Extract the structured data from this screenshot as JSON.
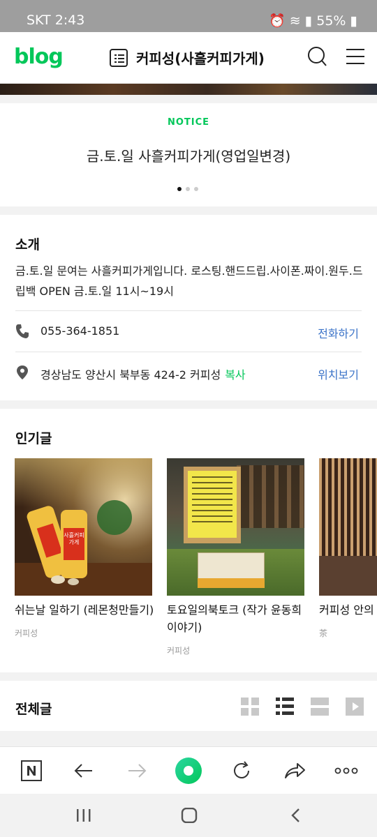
{
  "status": {
    "carrier_time": "SKT 2:43",
    "battery": "55%"
  },
  "header": {
    "logo": "blog",
    "title": "커피성(사흘커피가게)"
  },
  "notice": {
    "label": "NOTICE",
    "text": "금.토.일 사흘커피가게(영업일변경)"
  },
  "intro": {
    "title": "소개",
    "description": "금.토.일 문여는 사흘커피가게입니다. 로스팅.핸드드립.사이폰.짜이.원두.드립백 OPEN 금.토.일 11시~19시",
    "phone": "055-364-1851",
    "phone_action": "전화하기",
    "address": "경상남도 양산시 북부동 424-2 커피성",
    "copy": "복사",
    "address_action": "위치보기"
  },
  "popular": {
    "title": "인기글",
    "items": [
      {
        "title": "쉬는날 일하기 (레몬청만들기)",
        "category": "커피성",
        "thumb_label": "사흘커피가게"
      },
      {
        "title": "토요일의북토크 (작가 윤동희 이야기)",
        "category": "커피성"
      },
      {
        "title": "커피성 안의 차/Matcha",
        "category": "茶"
      }
    ]
  },
  "all_posts": {
    "title": "전체글"
  },
  "icons": {
    "list": "list-icon",
    "search": "search-icon",
    "menu": "menu-icon",
    "phone": "phone-icon",
    "pin": "location-pin-icon",
    "views": [
      "grid-view-icon",
      "list-view-icon",
      "card-view-icon",
      "video-view-icon"
    ],
    "browser": [
      "naver-n-icon",
      "back-arrow-icon",
      "forward-arrow-icon",
      "naver-home-icon",
      "refresh-icon",
      "share-icon",
      "more-icon"
    ]
  },
  "colors": {
    "brand": "#03c75a",
    "link": "#3b73c8"
  }
}
